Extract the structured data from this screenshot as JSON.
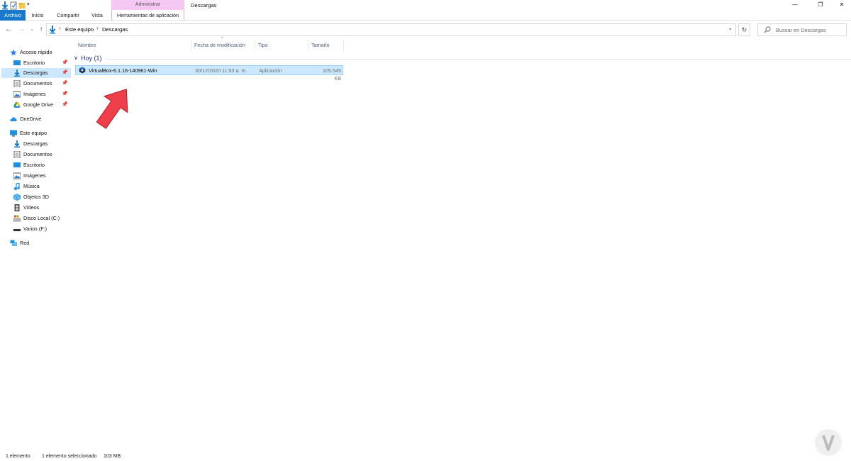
{
  "colors": {
    "archivo_tab": "#1979ca",
    "contextual_tab": "#f7c7f4",
    "selection": "#cce8ff",
    "selection_border": "#99d1ff",
    "group_header": "#1e3287",
    "arrow": "#ef3f4a"
  },
  "window": {
    "title": "Descargas",
    "context_group": "Administrar",
    "controls": {
      "minimize": "—",
      "restore": "❐",
      "close": "✕"
    }
  },
  "ribbon": {
    "tabs": [
      {
        "label": "Archivo",
        "active": true
      },
      {
        "label": "Inicio"
      },
      {
        "label": "Compartir"
      },
      {
        "label": "Vista"
      },
      {
        "label": "Herramientas de aplicación"
      }
    ]
  },
  "address_bar": {
    "crumbs": [
      "Este equipo",
      "Descargas"
    ],
    "separator": "›",
    "dropdown": "⌄"
  },
  "nav_buttons": {
    "back": "←",
    "forward": "→",
    "recent": "⌄",
    "up": "↑",
    "refresh": "↻"
  },
  "search": {
    "placeholder": "Buscar en Descargas"
  },
  "sidebar": {
    "quick_access": {
      "label": "Acceso rápido",
      "items": [
        {
          "label": "Escritorio",
          "icon": "desktop-icon",
          "pinned": true
        },
        {
          "label": "Descargas",
          "icon": "download-icon",
          "pinned": true,
          "selected": true
        },
        {
          "label": "Documentos",
          "icon": "documents-icon",
          "pinned": true
        },
        {
          "label": "Imágenes",
          "icon": "pictures-icon",
          "pinned": true
        },
        {
          "label": "Google Drive",
          "icon": "google-drive-icon",
          "pinned": true
        }
      ]
    },
    "onedrive": {
      "label": "OneDrive"
    },
    "this_pc": {
      "label": "Este equipo",
      "items": [
        {
          "label": "Descargas",
          "icon": "download-icon"
        },
        {
          "label": "Documentos",
          "icon": "documents-icon"
        },
        {
          "label": "Escritorio",
          "icon": "desktop-icon"
        },
        {
          "label": "Imágenes",
          "icon": "pictures-icon"
        },
        {
          "label": "Música",
          "icon": "music-icon"
        },
        {
          "label": "Objetos 3D",
          "icon": "3d-objects-icon"
        },
        {
          "label": "Vídeos",
          "icon": "videos-icon"
        },
        {
          "label": "Disco Local (C:)",
          "icon": "local-disk-icon"
        },
        {
          "label": "Varios (F:)",
          "icon": "drive-icon"
        }
      ]
    },
    "network": {
      "label": "Red"
    },
    "pin_glyph": "📌"
  },
  "file_list": {
    "columns": [
      "Nombre",
      "Fecha de modificación",
      "Tipo",
      "Tamaño"
    ],
    "group": {
      "title": "Hoy (1)",
      "toggle": "∨"
    },
    "rows": [
      {
        "name": "VirtualBox-6.1.16-140961-Win",
        "date": "30/12/2020 11:53 a. m.",
        "type": "Aplicación",
        "size": "105.545 KB",
        "selected": true
      }
    ]
  },
  "status_bar": {
    "count": "1 elemento",
    "selected": "1 elemento seleccionado",
    "size": "103 MB"
  }
}
